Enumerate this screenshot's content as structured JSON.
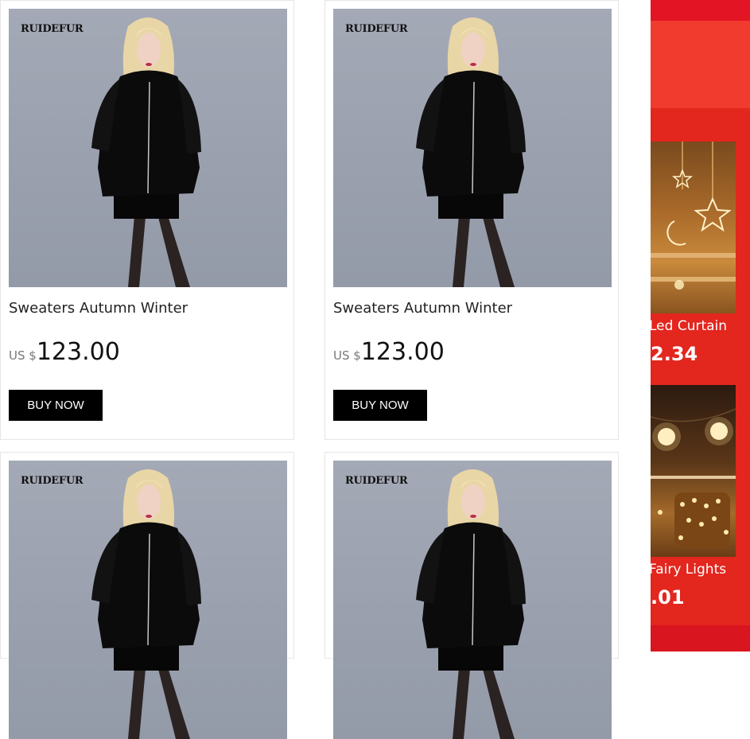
{
  "products": [
    {
      "brand": "RUIDEFUR",
      "title": "Sweaters Autumn Winter",
      "currency": "US $",
      "price": "123.00",
      "buy_label": "BUY NOW"
    },
    {
      "brand": "RUIDEFUR",
      "title": "Sweaters Autumn Winter",
      "currency": "US $",
      "price": "123.00",
      "buy_label": "BUY NOW"
    },
    {
      "brand": "RUIDEFUR"
    },
    {
      "brand": "RUIDEFUR"
    }
  ],
  "promo": {
    "items": [
      {
        "name": "Led Curtain",
        "price": "2.34"
      },
      {
        "name": "Fairy Lights",
        "price": ".01"
      }
    ]
  },
  "colors": {
    "promo_bg": "#e3261e",
    "button_bg": "#000000",
    "photo_bg": "#9ea4b2"
  }
}
